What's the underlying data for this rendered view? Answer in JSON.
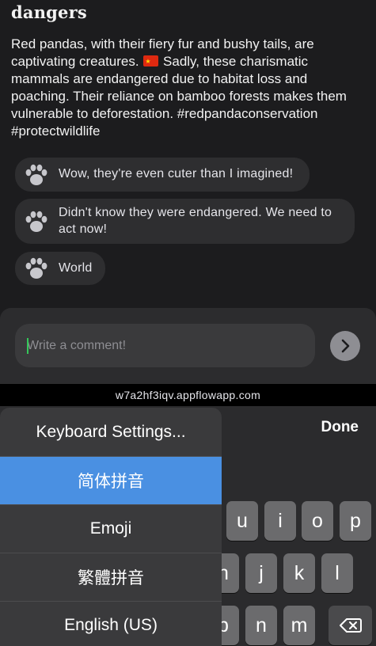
{
  "post": {
    "title": "dangers",
    "body_before_flag": "Red pandas, with their fiery fur and bushy tails, are captivating creatures. ",
    "body_after_flag": " Sadly, these charismatic mammals are endangered due to habitat loss and poaching. Their reliance on bamboo forests makes them vulnerable to deforestation. #redpandaconservation #protectwildlife"
  },
  "comments": [
    {
      "icon": "paw-icon",
      "text": "Wow, they're even cuter than I imagined!"
    },
    {
      "icon": "paw-icon",
      "text": "Didn't know they were endangered. We need to act now!"
    },
    {
      "icon": "paw-icon",
      "text": "World"
    }
  ],
  "composer": {
    "placeholder": "Write a comment!",
    "send_icon": "chevron-right-icon"
  },
  "browser": {
    "url": "w7a2hf3iqv.appflowapp.com"
  },
  "keyboard": {
    "done_label": "Done",
    "keys_row1": [
      "u",
      "i",
      "o",
      "p"
    ],
    "keys_row2": [
      "h",
      "j",
      "k",
      "l"
    ],
    "keys_row3": [
      "b",
      "n",
      "m"
    ],
    "delete_icon": "backspace-icon"
  },
  "language_menu": {
    "items": [
      {
        "label": "Keyboard Settings...",
        "selected": false
      },
      {
        "label": "简体拼音",
        "selected": true
      },
      {
        "label": "Emoji",
        "selected": false
      },
      {
        "label": "繁體拼音",
        "selected": false
      },
      {
        "label": "English (US)",
        "selected": false
      }
    ]
  },
  "colors": {
    "background": "#1c1c1e",
    "bubble": "#2e2e30",
    "selected_menu_item": "#4a90e2",
    "caret": "#34c759"
  }
}
